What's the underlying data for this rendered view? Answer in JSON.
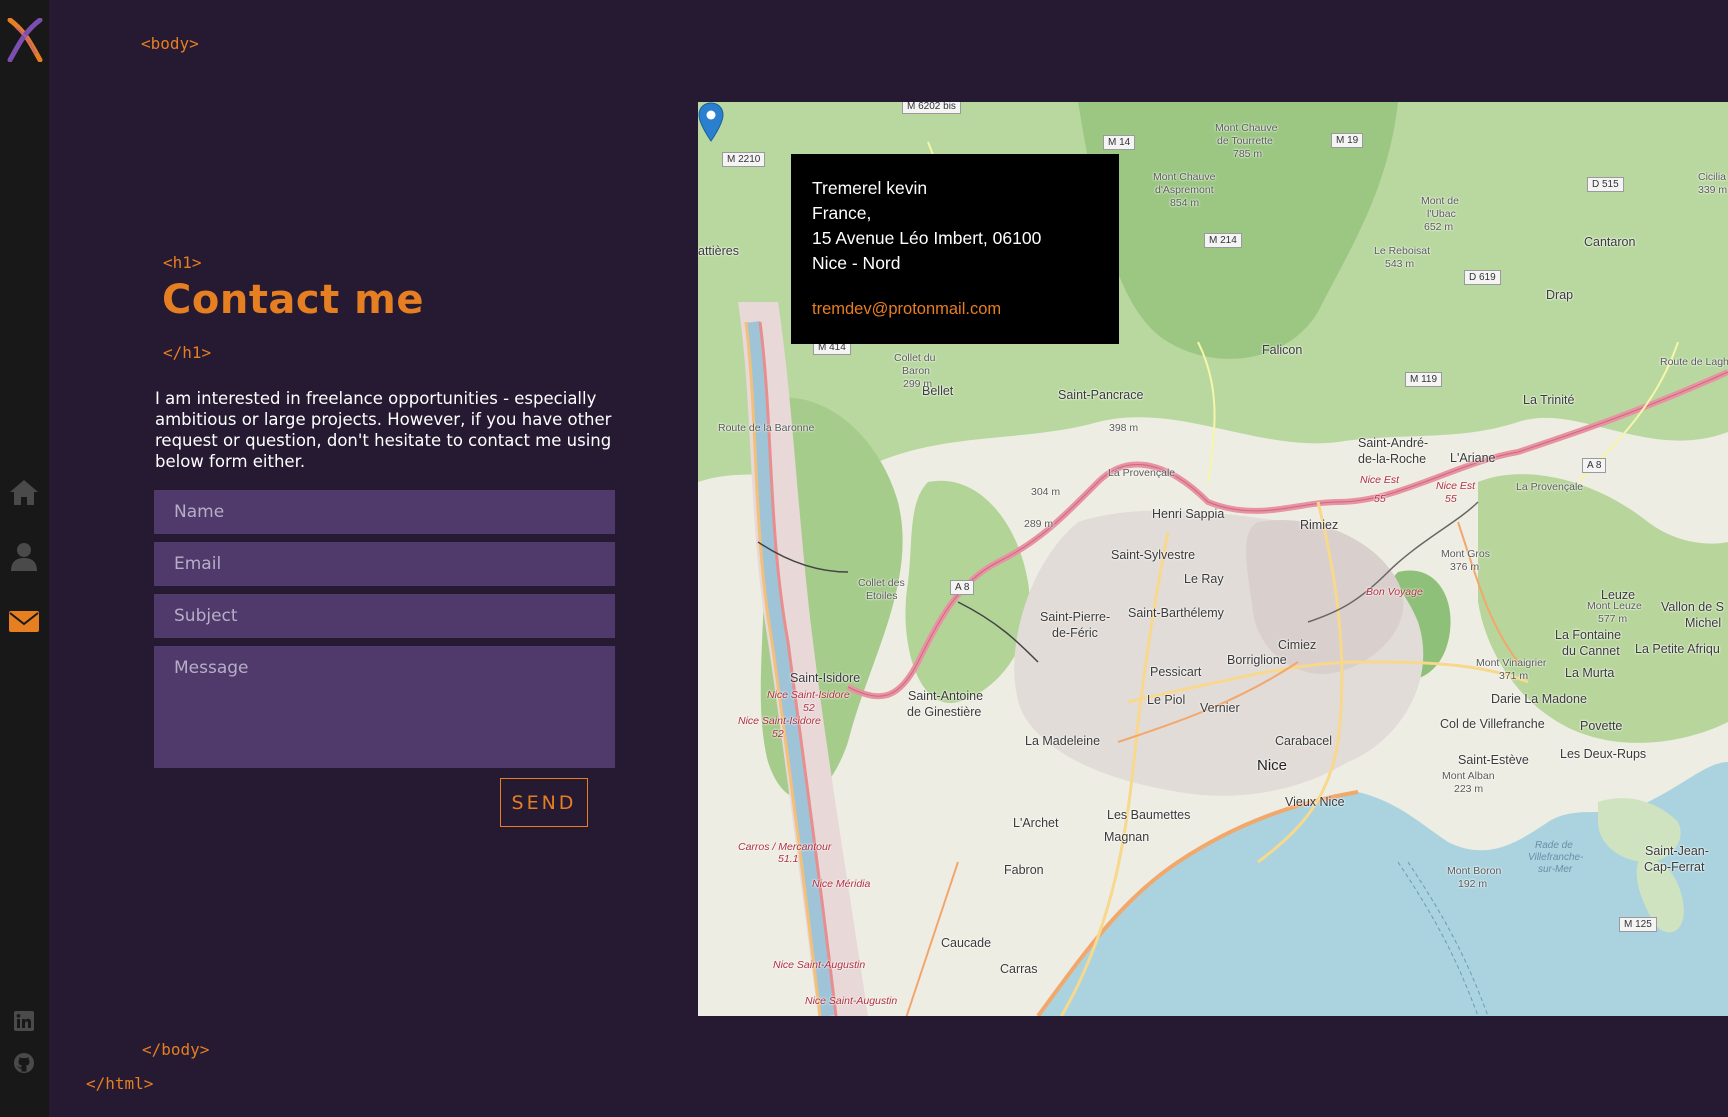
{
  "tags": {
    "body_open": "<body>",
    "h1_open": "<h1>",
    "h1_close": "</h1>",
    "body_close": "</body>",
    "html_close": "</html>"
  },
  "page": {
    "title": "Contact me",
    "intro": "I am interested in freelance opportunities - especially ambitious or large projects. However, if you have other request or question, don't hesitate to contact me using below form either."
  },
  "form": {
    "name_placeholder": "Name",
    "email_placeholder": "Email",
    "subject_placeholder": "Subject",
    "message_placeholder": "Message",
    "send_label": "SEND"
  },
  "sidebar": {
    "items": [
      {
        "icon": "home-icon",
        "active": false
      },
      {
        "icon": "user-icon",
        "active": false
      },
      {
        "icon": "envelope-icon",
        "active": true
      }
    ],
    "social": [
      {
        "icon": "linkedin-icon"
      },
      {
        "icon": "github-icon"
      }
    ]
  },
  "contact": {
    "name": "Tremerel kevin",
    "country": "France,",
    "address": "15 Avenue Léo Imbert, 06100",
    "district": "Nice - Nord",
    "email": "tremdev@protonmail.com"
  },
  "map": {
    "places": {
      "nice": "Nice",
      "bellet": "Bellet",
      "saint_pancrace": "Saint-Pancrace",
      "falicon": "Falicon",
      "la_trinite": "La Trinité",
      "saint_andre": "Saint-André-",
      "saint_andre2": "de-la-Roche",
      "l_ariane": "L'Ariane",
      "henri_sappia": "Henri Sappia",
      "rimiez": "Rimiez",
      "saint_sylvestre": "Saint-Sylvestre",
      "le_ray": "Le Ray",
      "saint_barthelemy": "Saint-Barthélemy",
      "saint_pierre": "Saint-Pierre-",
      "saint_pierre2": "de-Féric",
      "cimiez": "Cimiez",
      "borriglione": "Borriglione",
      "pessicart": "Pessicart",
      "le_piol": "Le Piol",
      "vernier": "Vernier",
      "carabacel": "Carabacel",
      "saint_isidore": "Saint-Isidore",
      "saint_antoine": "Saint-Antoine",
      "saint_antoine2": "de Ginestière",
      "la_madeleine": "La Madeleine",
      "vieux_nice": "Vieux Nice",
      "les_baumettes": "Les Baumettes",
      "magnan": "Magnan",
      "l_archet": "L'Archet",
      "fabron": "Fabron",
      "caucade": "Caucade",
      "carras": "Carras",
      "leuze": "Leuze",
      "la_fontaine": "La Fontaine",
      "la_fontaine2": "du Cannet",
      "la_murta": "La Murta",
      "darie": "Darie La Madone",
      "col_villefranche": "Col de Villefranche",
      "povette": "Povette",
      "saint_esteve": "Saint-Estève",
      "deux_rups": "Les Deux-Rups",
      "saint_jean": "Saint-Jean-",
      "saint_jean2": "Cap-Ferrat",
      "vallon": "Vallon de S",
      "vallon2": "Michel",
      "petite_afrique": "La Petite Afriqu",
      "drap": "Drap",
      "cantaron": "Cantaron",
      "attieres": "attières",
      "cimiez_peak": "Cicilia",
      "mont_chauve": "Mont Chauve",
      "mont_chauve2": "d'Aspremont",
      "mont_chauve3": "854 m",
      "mont_tourrette": "Mont Chauve",
      "mont_tourrette2": "de Tourrette",
      "mont_tourrette3": "785 m",
      "le_reboisat": "Le Reboisat",
      "le_reboisat2": "543 m",
      "mont_ubac": "Mont de",
      "mont_ubac2": "l'Ubac",
      "mont_ubac3": "652 m",
      "collet_baron": "Collet du",
      "collet_baron2": "Baron",
      "collet_baron3": "299 m",
      "collet_etoiles": "Collet des",
      "collet_etoiles2": "Etoiles",
      "mont_gros": "Mont Gros",
      "mont_gros2": "376 m",
      "mont_leuze": "Mont Leuze",
      "mont_leuze2": "577 m",
      "mont_vinaigrier": "Mont Vinaigrier",
      "mont_vinaigrier2": "371 m",
      "mont_alban": "Mont Alban",
      "mont_alban2": "223 m",
      "mont_boron": "Mont Boron",
      "mont_boron2": "192 m",
      "alt_304": "304 m",
      "alt_289": "289 m",
      "alt_398": "398 m",
      "cicilia_alt": "339 m",
      "nice_est": "Nice Est",
      "nice_est2": "Nice Est",
      "nice_st_isidore": "Nice Saint-Isidore",
      "nice_st_isidore2": "Nice Saint-Isidore",
      "carros_merc": "Carros / Mercantour",
      "nice_meridia": "Nice Méridia",
      "nice_st_augustin": "Nice Saint-Augustin",
      "nice_st_augustin2": "Nice Saint-Augustin",
      "bon_voyage": "Bon Voyage",
      "rade": "Rade de",
      "rade2": "Villefranche-",
      "rade3": "sur-Mer",
      "la_provencale": "La Provençale",
      "la_provencale2": "La Provençale",
      "route_laghet": "Route de Laghet",
      "route_baronne": "Route de la Baronne"
    },
    "roads": {
      "m6202": "M 6202 bis",
      "m2210": "M 2210",
      "m14": "M 14",
      "m19": "M 19",
      "d515": "D 515",
      "m214": "M 214",
      "d619": "D 619",
      "m414": "M 414",
      "m119": "M 119",
      "a8a": "A 8",
      "a8b": "A 8",
      "m125": "M 125",
      "e55a": "55",
      "e55b": "55",
      "e52a": "52",
      "e52b": "52",
      "e511": "51.1"
    }
  }
}
